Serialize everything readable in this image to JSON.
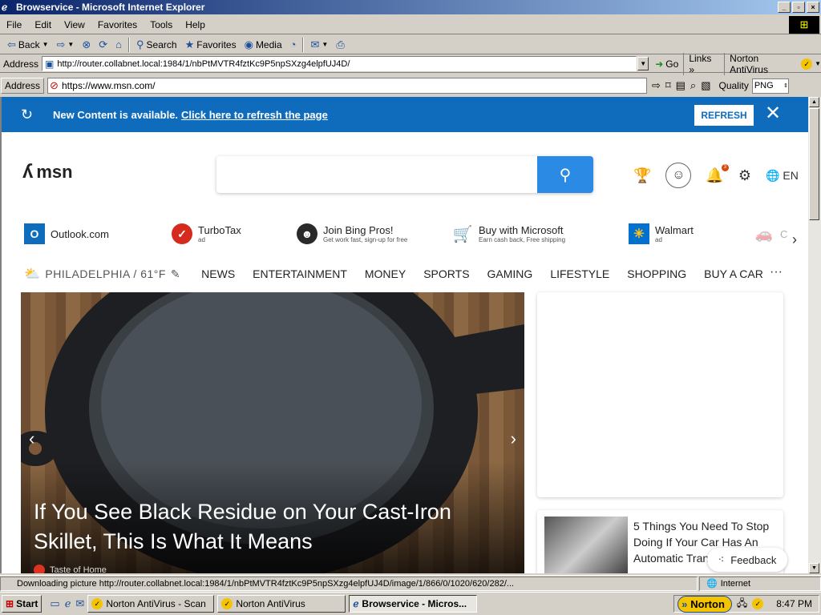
{
  "window": {
    "title": "Browservice - Microsoft Internet Explorer",
    "controls": [
      "_",
      "▫",
      "×"
    ]
  },
  "menu": [
    "File",
    "Edit",
    "View",
    "Favorites",
    "Tools",
    "Help"
  ],
  "toolbar": {
    "back": "Back",
    "search": "Search",
    "favorites": "Favorites",
    "media": "Media"
  },
  "ie_address": {
    "label": "Address",
    "url": "http://router.collabnet.local:1984/1/nbPtMVTR4fztKc9P5npSXzg4elpfUJ4D/",
    "go": "Go",
    "links": "Links",
    "norton": "Norton AntiVirus"
  },
  "bs_address": {
    "label": "Address",
    "url": "https://www.msn.com/",
    "quality_label": "Quality",
    "quality_value": "PNG"
  },
  "banner": {
    "text": "New Content is available.",
    "link": "Click here to refresh the page",
    "button": "REFRESH"
  },
  "msn": {
    "logo": "msn",
    "search_placeholder": "",
    "lang": "EN",
    "notif_count": "3",
    "quicklinks": [
      {
        "name": "Outlook.com",
        "sub": ""
      },
      {
        "name": "TurboTax",
        "sub": "ad"
      },
      {
        "name": "Join Bing Pros!",
        "sub": "Get work fast, sign-up for free"
      },
      {
        "name": "Buy with Microsoft",
        "sub": "Earn cash back, Free shipping"
      },
      {
        "name": "Walmart",
        "sub": "ad"
      },
      {
        "name": "C",
        "sub": ""
      }
    ],
    "weather": "PHILADELPHIA / 61°F",
    "nav": [
      "NEWS",
      "ENTERTAINMENT",
      "MONEY",
      "SPORTS",
      "GAMING",
      "LIFESTYLE",
      "SHOPPING",
      "BUY A CAR"
    ],
    "more": "···",
    "hero": {
      "title": "If You See Black Residue on Your Cast-Iron Skillet, This Is What It Means",
      "source": "Taste of Home"
    },
    "card2": {
      "title": "5 Things You Need To Stop Doing If Your Car Has An Automatic Tran..."
    },
    "feedback": "Feedback"
  },
  "status": {
    "message": "Downloading picture http://router.collabnet.local:1984/1/nbPtMVTR4fztKc9P5npSXzg4elpfUJ4D/image/1/866/0/1020/620/282/...",
    "zone": "Internet"
  },
  "taskbar": {
    "start": "Start",
    "tasks": [
      "Norton AntiVirus - Scan",
      "Norton AntiVirus",
      "Browservice - Micros..."
    ],
    "norton": "Norton",
    "time": "8:47 PM"
  },
  "colors": {
    "banner": "#0f6cbd",
    "search_btn": "#2b8ae3",
    "title_grad_start": "#0a246a"
  }
}
